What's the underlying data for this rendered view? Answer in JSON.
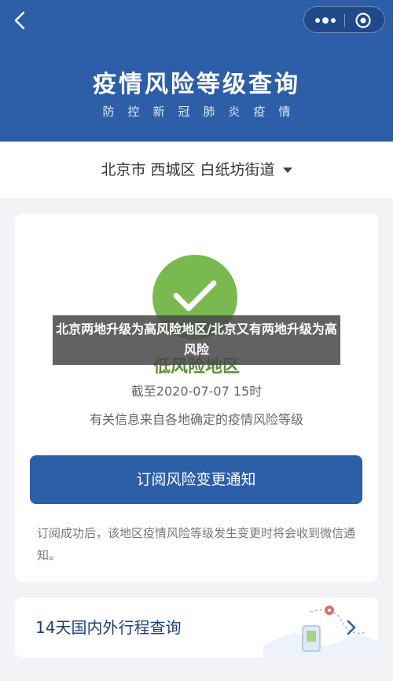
{
  "header": {
    "title": "疫情风险等级查询",
    "subtitle": "防控新冠肺炎疫情",
    "color": "#2d5ea8"
  },
  "location": {
    "text": "北京市 西城区 白纸坊街道"
  },
  "risk": {
    "level_text": "低风险地区",
    "deadline": "截至2020-07-07 15时",
    "note": "有关信息来自各地确定的疫情风险等级",
    "color": "#79b94f"
  },
  "subscribe": {
    "button_label": "订阅风险变更通知",
    "note": "订阅成功后，该地区疫情风险等级发生变更时将会收到微信通知。"
  },
  "trip": {
    "label": "14天国内外行程查询"
  },
  "overlay": {
    "headline": "北京两地升级为高风险地区/北京又有两地升级为高风险"
  }
}
